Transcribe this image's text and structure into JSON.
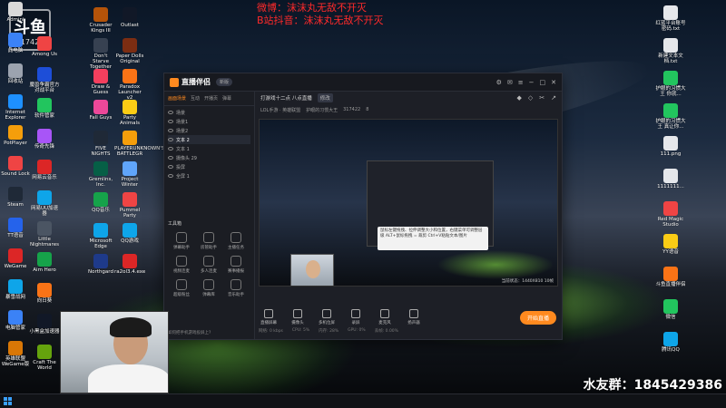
{
  "overlay": {
    "line1": "微博：沫沫丸无敌不开灭",
    "line2": "B站抖音：沫沫丸无敌不开灭",
    "watermark": "水友群：1845429386"
  },
  "logo": {
    "big": "斗鱼",
    "small": "317422"
  },
  "desktop_icons_left": [
    {
      "label": "Admini",
      "color": "#d9d9d9"
    },
    {
      "label": "此电脑",
      "color": "#3b82f6"
    },
    {
      "label": "回收站",
      "color": "#9ca3af"
    },
    {
      "label": "Internet Explorer",
      "color": "#1e90ff"
    },
    {
      "label": "PotPlayer",
      "color": "#f59e0b"
    },
    {
      "label": "Sound Lock",
      "color": "#ef4444"
    },
    {
      "label": "Steam",
      "color": "#1f2937"
    },
    {
      "label": "TT语音",
      "color": "#2563eb"
    },
    {
      "label": "WeGame",
      "color": "#dc2626"
    },
    {
      "label": "暴雪战网",
      "color": "#0ea5e9"
    },
    {
      "label": "电脑管家",
      "color": "#3b82f6"
    },
    {
      "label": "英雄联盟 WeGame版",
      "color": "#d97706"
    }
  ],
  "desktop_icons_col2": [
    {
      "label": "Among Us",
      "color": "#ef4444"
    },
    {
      "label": "魔兽争霸官方对战平台",
      "color": "#1d4ed8"
    },
    {
      "label": "软件管家",
      "color": "#22c55e"
    },
    {
      "label": "传奇先锋",
      "color": "#a855f7"
    },
    {
      "label": "网易云音乐",
      "color": "#dc2626"
    },
    {
      "label": "网易UU加速器",
      "color": "#0ea5e9"
    },
    {
      "label": "Little Nightmares",
      "color": "#4b5563"
    },
    {
      "label": "Aim Hero",
      "color": "#16a34a"
    },
    {
      "label": "向日葵",
      "color": "#f97316"
    },
    {
      "label": "小黑盒加速器",
      "color": "#111827"
    },
    {
      "label": "Craft The World",
      "color": "#65a30d"
    }
  ],
  "desktop_icons_col3": [
    {
      "label": "Crusader Kings III",
      "color": "#b45309"
    },
    {
      "label": "Don't Starve Together",
      "color": "#374151"
    },
    {
      "label": "Draw & Guess",
      "color": "#f43f5e"
    },
    {
      "label": "Fall Guys",
      "color": "#ec4899"
    },
    {
      "label": "FIVE NIGHTS",
      "color": "#1f2937"
    },
    {
      "label": "Gremlins, Inc.",
      "color": "#065f46"
    },
    {
      "label": "QQ音乐",
      "color": "#16a34a"
    },
    {
      "label": "Microsoft Edge",
      "color": "#0ea5e9"
    },
    {
      "label": "Northgard",
      "color": "#1e3a8a"
    }
  ],
  "desktop_icons_col4": [
    {
      "label": "Outlast",
      "color": "#111827"
    },
    {
      "label": "Paper Dolls Original",
      "color": "#7c2d12"
    },
    {
      "label": "Paradox Launcher v2",
      "color": "#f97316"
    },
    {
      "label": "Party Animals",
      "color": "#facc15"
    },
    {
      "label": "PLAYERUNKNOWN'S BATTLEGR",
      "color": "#f59e0b"
    },
    {
      "label": "Project Winter",
      "color": "#60a5fa"
    },
    {
      "label": "Pummel Party",
      "color": "#ef4444"
    },
    {
      "label": "QQ游戏",
      "color": "#0ea5e9"
    },
    {
      "label": "ra2ol3.4.exe",
      "color": "#dc2626"
    }
  ],
  "desktop_icons_right": [
    {
      "label": "红蓝平台账号密码.txt",
      "color": "#e5e7eb"
    },
    {
      "label": "新建文本文档.txt",
      "color": "#e5e7eb"
    },
    {
      "label": "护眼的习惯大王 你就...",
      "color": "#22c55e"
    },
    {
      "label": "护眼的习惯大王 真让你...",
      "color": "#22c55e"
    },
    {
      "label": "111.png",
      "color": "#e5e7eb"
    },
    {
      "label": "1111111...",
      "color": "#e5e7eb"
    },
    {
      "label": "Red Magic Studio",
      "color": "#ef4444"
    },
    {
      "label": "YY语音",
      "color": "#facc15"
    },
    {
      "label": "斗鱼直播伴侣",
      "color": "#f97316"
    },
    {
      "label": "微信",
      "color": "#22c55e"
    },
    {
      "label": "腾讯QQ",
      "color": "#0ea5e9"
    }
  ],
  "app": {
    "title": "直播伴侣",
    "version": "新版",
    "left_tabs": [
      "画面场景",
      "互动",
      "开播页",
      "弹幕"
    ],
    "scenes": [
      "场景",
      "场景1",
      "场景2",
      "文本 2",
      "文本 1",
      "摄像头 29",
      "投屏",
      "全屏 1"
    ],
    "tools_title": "工具箱",
    "tools": [
      "弹幕助手",
      "房管助手",
      "主播任务",
      "视频连麦",
      "多人连麦",
      "赛事播报",
      "超级粉丝",
      "弹幕库",
      "音乐助手"
    ],
    "footer_hint": "如何把手机游戏投屏上?",
    "stream_title": "打游戏十二点 八点直播",
    "edit_label": "修改",
    "category": "LOL手游 · 英雄联盟",
    "room": "护眼的习惯大王",
    "room_id": "317422",
    "fans": "8",
    "tip_text": "鼠标左键拖拽、拉伸调整大小和位置，右键菜单可调整层级 ALT+鼠标拖拽 = 裁剪 Ctrl+V粘贴文本/图片",
    "preview_status": "当前状态：1440X810 10帧",
    "bottom_tools": [
      "直播屏幕",
      "摄像头",
      "多机位屏",
      "录屏",
      "麦克风",
      "扬声器"
    ],
    "start_button": "开始直播",
    "stats": [
      "网络: 0 kbps",
      "CPU: 5%",
      "内存: 28%",
      "GPU: 0%",
      "丢帧: 0.00%"
    ]
  },
  "taskbar": {
    "start": "start-menu"
  }
}
